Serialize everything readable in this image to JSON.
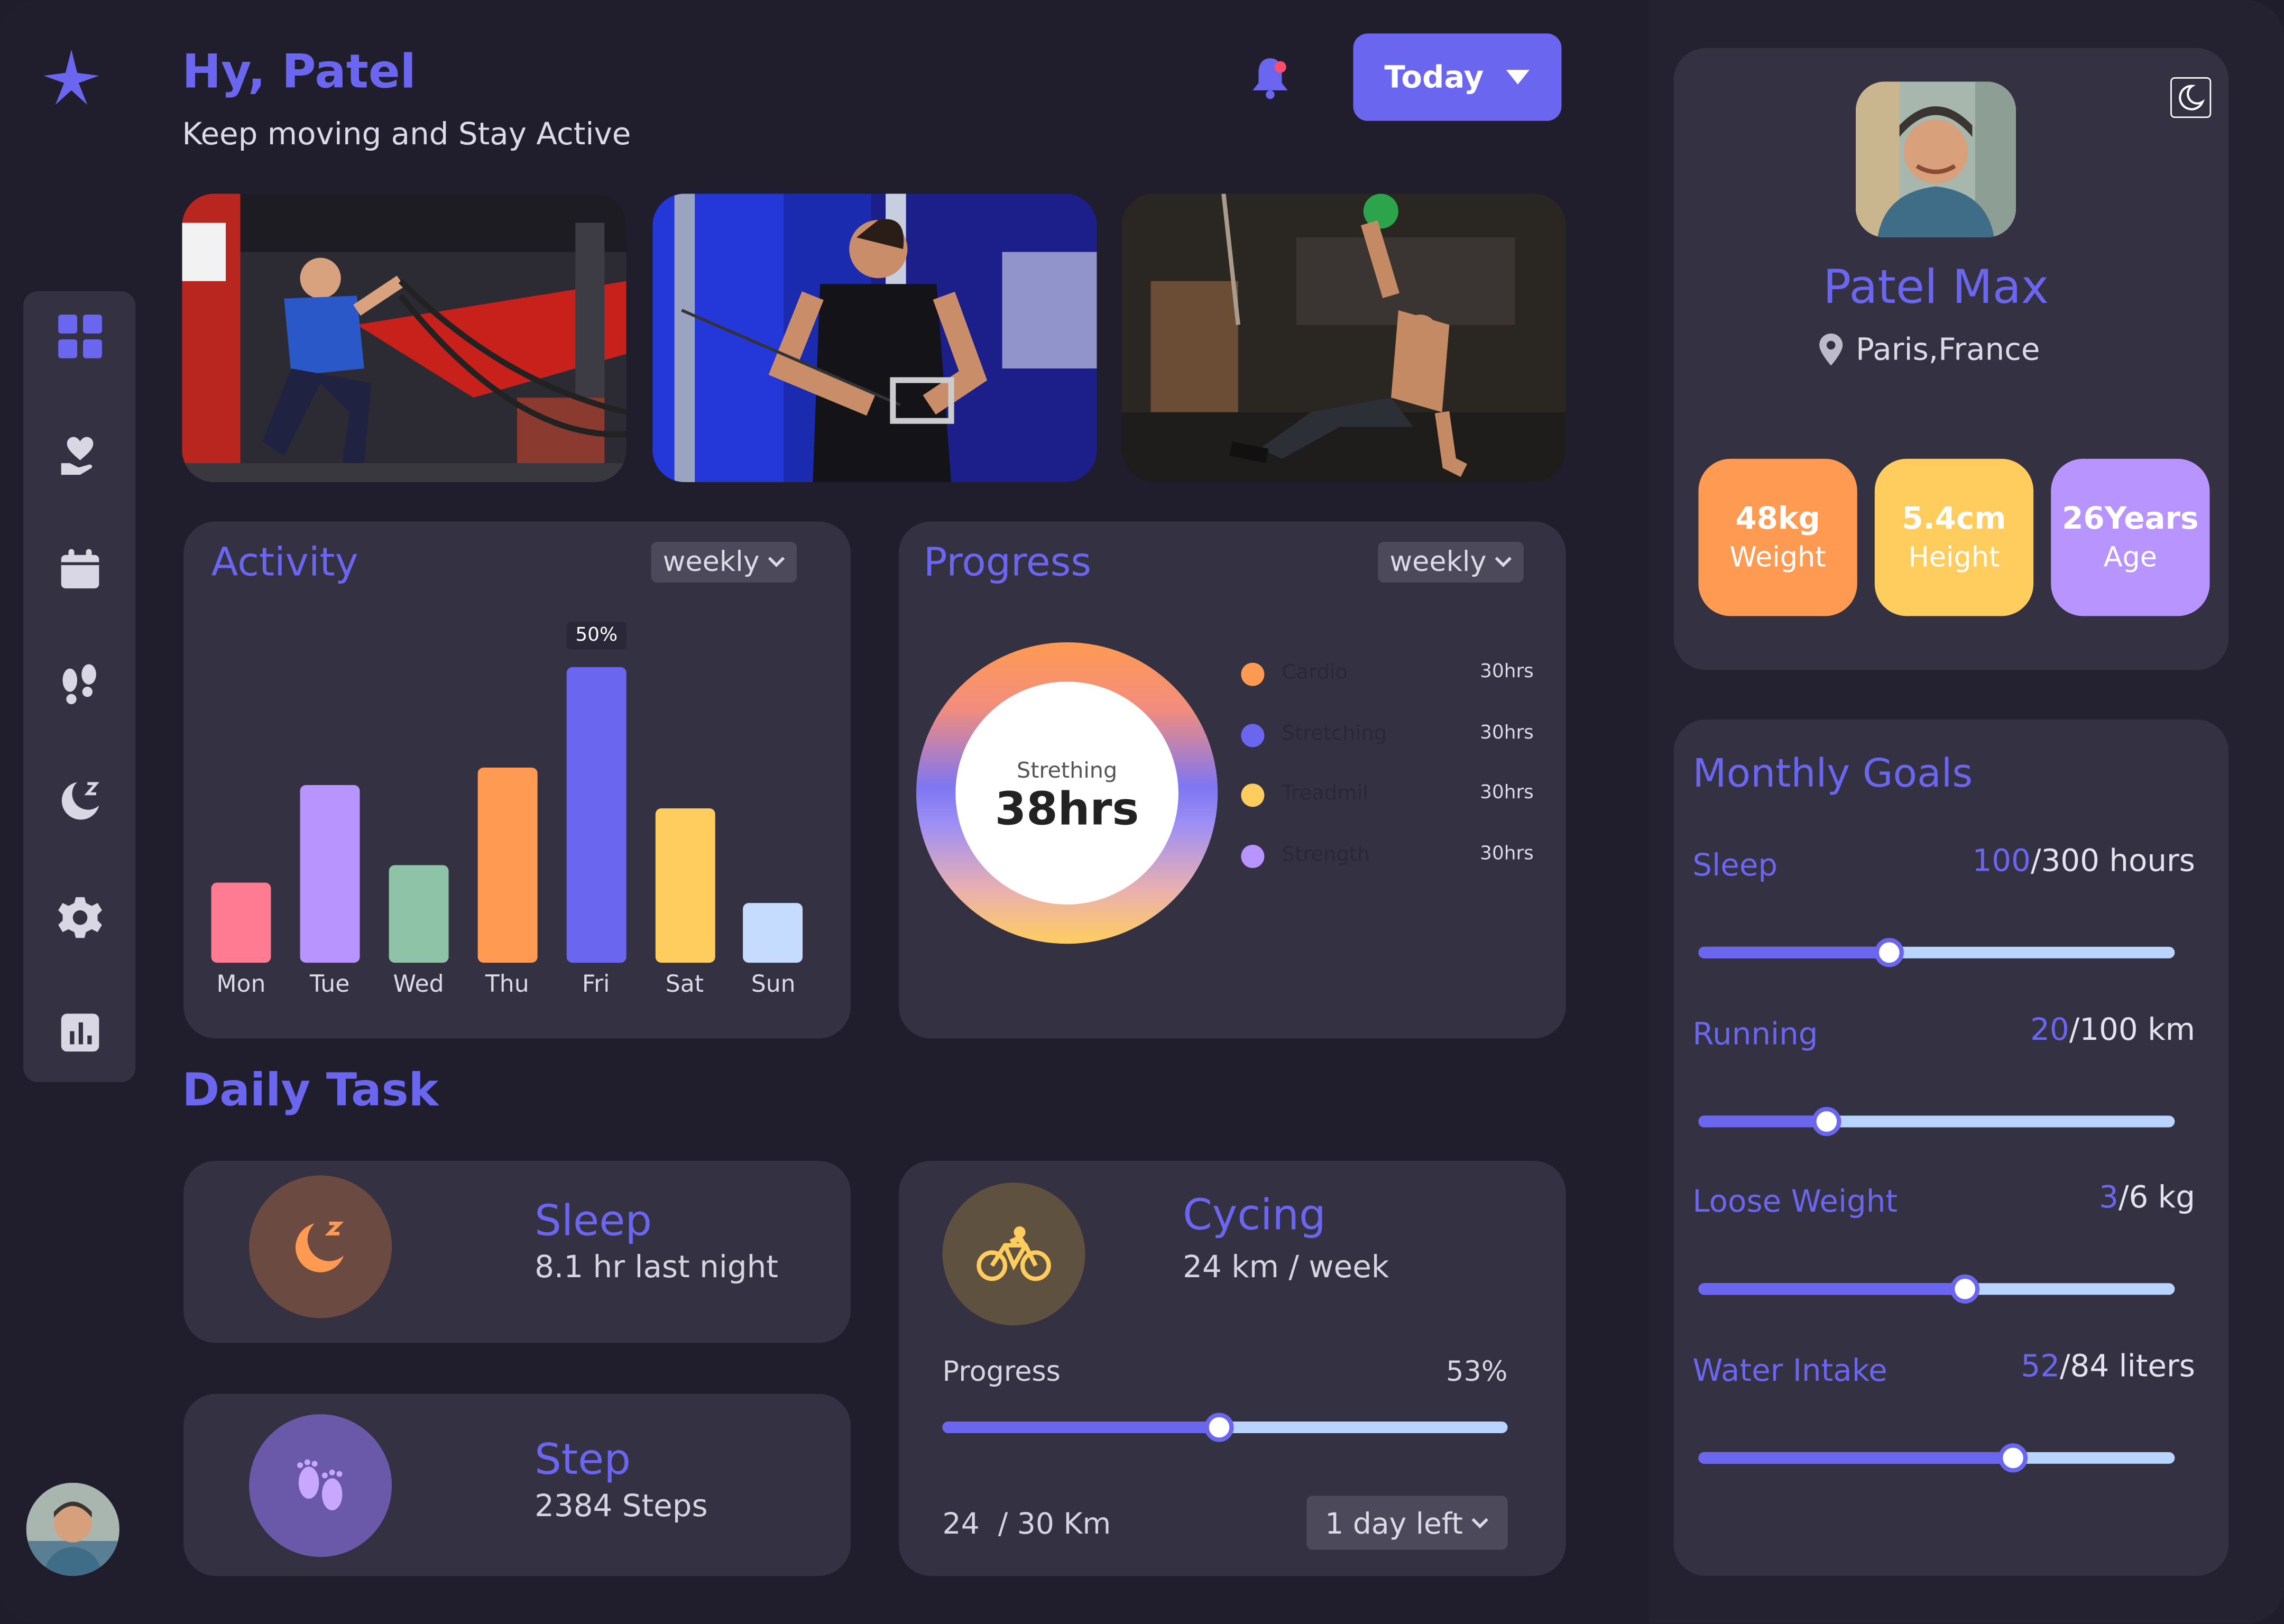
{
  "header": {
    "greeting": "Hy, Patel",
    "subtitle": "Keep moving and Stay Active",
    "period_button": "Today"
  },
  "sidebar": {
    "items": [
      {
        "icon": "dashboard-icon"
      },
      {
        "icon": "heart-hand-icon"
      },
      {
        "icon": "calendar-icon"
      },
      {
        "icon": "footsteps-icon"
      },
      {
        "icon": "sleep-moon-icon"
      },
      {
        "icon": "settings-icon"
      },
      {
        "icon": "stats-icon"
      }
    ]
  },
  "activity": {
    "title": "Activity",
    "filter": "weekly",
    "highlight_label": "50%",
    "chart_data": {
      "type": "bar",
      "categories": [
        "Mon",
        "Tue",
        "Wed",
        "Thu",
        "Fri",
        "Sat",
        "Sun"
      ],
      "values": [
        27,
        60,
        33,
        66,
        100,
        52,
        20
      ],
      "colors": [
        "#ff7b91",
        "#b794ff",
        "#8ec3a8",
        "#ff9a52",
        "#6b66f0",
        "#ffcd5e",
        "#c5dcff"
      ]
    }
  },
  "progress": {
    "title": "Progress",
    "filter": "weekly",
    "center_label": "Strething",
    "center_value": "38hrs",
    "legend": [
      {
        "label": "Cardio",
        "value": "30hrs",
        "color": "#ff9a52"
      },
      {
        "label": "Stretching",
        "value": "30hrs",
        "color": "#6b66f0"
      },
      {
        "label": "Treadmil",
        "value": "30hrs",
        "color": "#ffcd5e"
      },
      {
        "label": "Strength",
        "value": "30hrs",
        "color": "#b794ff"
      }
    ]
  },
  "daily_task": {
    "title": "Daily Task",
    "sleep": {
      "title": "Sleep",
      "detail": "8.1 hr last night"
    },
    "step": {
      "title": "Step",
      "detail": "2384 Steps"
    },
    "cycling": {
      "title": "Cycing",
      "detail": "24 km / week",
      "progress_label": "Progress",
      "progress_value": "53%",
      "progress_fraction": 0.49,
      "distance": "24  / 30 Km",
      "deadline": "1 day left"
    }
  },
  "profile": {
    "name": "Patel Max",
    "location": "Paris,France",
    "stats": [
      {
        "value": "48kg",
        "label": "Weight",
        "color": "#ff9a52"
      },
      {
        "value": "5.4cm",
        "label": "Height",
        "color": "#ffcd5e"
      },
      {
        "value": "26Years",
        "label": "Age",
        "color": "#b794ff"
      }
    ]
  },
  "monthly_goals": {
    "title": "Monthly Goals",
    "goals": [
      {
        "label": "Sleep",
        "current": "100",
        "target": "/300 hours",
        "fraction": 0.4
      },
      {
        "label": "Running",
        "current": "20",
        "target": "/100 km",
        "fraction": 0.27
      },
      {
        "label": "Loose Weight",
        "current": "3",
        "target": "/6 kg",
        "fraction": 0.56
      },
      {
        "label": "Water Intake",
        "current": "52",
        "target": "/84 liters",
        "fraction": 0.66
      }
    ]
  }
}
